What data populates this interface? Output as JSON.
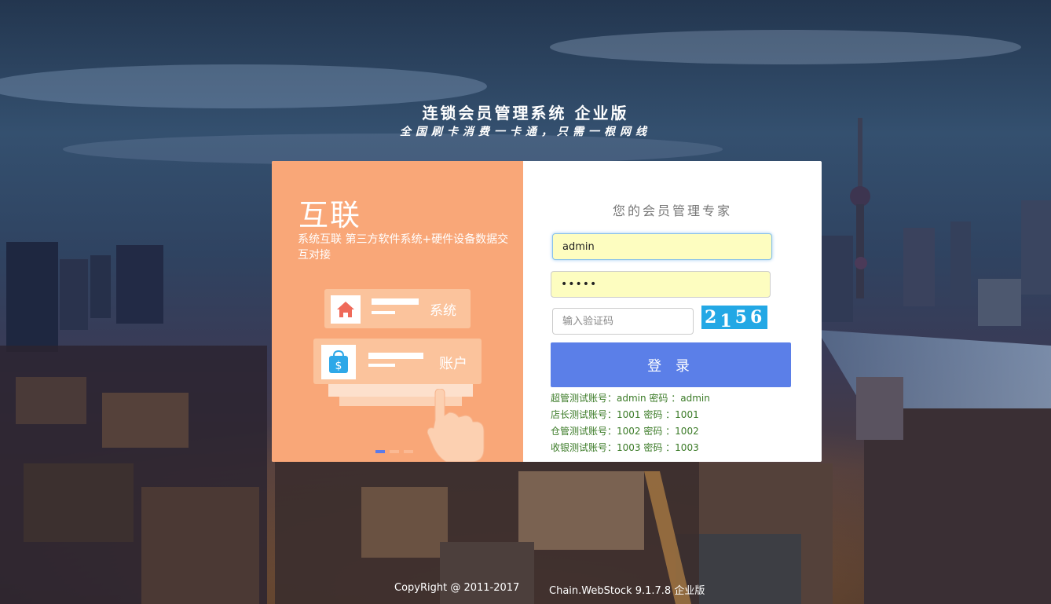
{
  "header": {
    "title": "连锁会员管理系统 企业版",
    "slogan": "全国刷卡消费一卡通，只需一根网线"
  },
  "promo": {
    "title": "互联",
    "description": "系统互联 第三方软件系统+硬件设备数据交互对接",
    "panels": [
      {
        "icon": "home-icon",
        "label": "系统"
      },
      {
        "icon": "wallet-icon",
        "label": "账户"
      }
    ],
    "carousel": {
      "count": 3,
      "active": 0
    }
  },
  "login": {
    "heading": "您的会员管理专家",
    "username_value": "admin",
    "password_value": "•••••",
    "captcha_placeholder": "输入验证码",
    "captcha_chars": [
      "2",
      "1",
      "5",
      "6"
    ],
    "submit_label": "登 录",
    "hints": [
      "超管测试账号：admin 密码 ：admin",
      "店长测试账号：1001 密码 ：1001",
      "仓管测试账号：1002 密码 ：1002",
      "收银测试账号：1003 密码 ：1003"
    ]
  },
  "footer": {
    "copyright": "CopyRight @ 2011-2017",
    "version": "Chain.WebStock 9.1.7.8 企业版"
  },
  "colors": {
    "promo_bg": "#f9a778",
    "login_button": "#5b7fe8",
    "captcha_bg": "#23a8e5",
    "hint_text": "#3a7a26"
  }
}
